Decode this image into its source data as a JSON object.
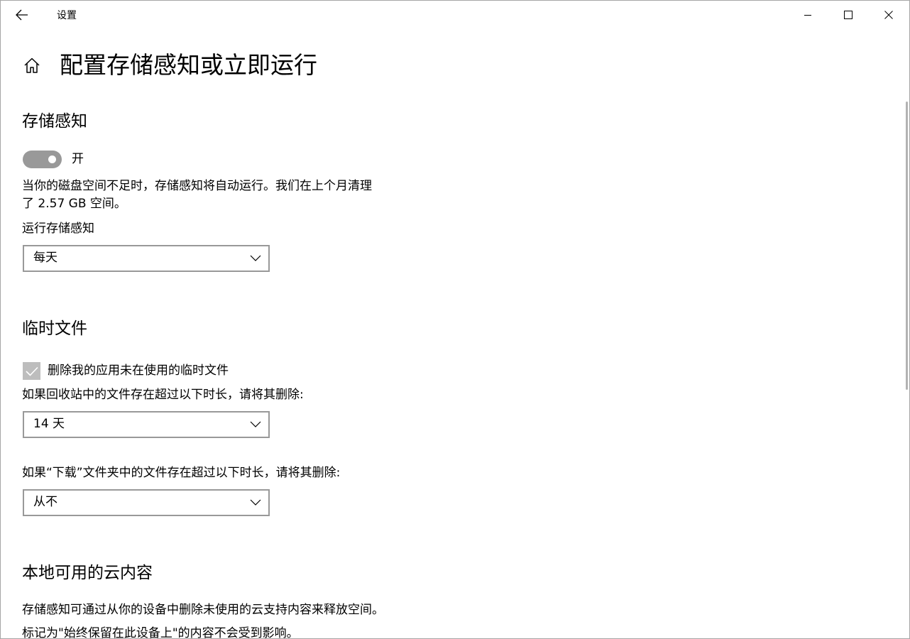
{
  "window": {
    "app_title": "设置"
  },
  "header": {
    "page_title": "配置存储感知或立即运行"
  },
  "storage_sense": {
    "section_title": "存储感知",
    "toggle_state": "开",
    "description_line1": "当你的磁盘空间不足时，存储感知将自动运行。我们在上个月清理",
    "description_line2": "了 2.57 GB 空间。",
    "run_label": "运行存储感知",
    "run_value": "每天"
  },
  "temp_files": {
    "section_title": "临时文件",
    "delete_temp_label": "删除我的应用未在使用的临时文件",
    "delete_temp_checked": true,
    "recycle_label": "如果回收站中的文件存在超过以下时长，请将其删除:",
    "recycle_value": "14 天",
    "downloads_label": "如果“下载”文件夹中的文件存在超过以下时长，请将其删除:",
    "downloads_value": "从不"
  },
  "cloud_content": {
    "section_title": "本地可用的云内容",
    "description_line1": "存储感知可通过从你的设备中删除未使用的云支持内容来释放空间。",
    "description_line2": "标记为\"始终保留在此设备上\"的内容不会受到影响。"
  },
  "icons": {
    "back": "back-arrow-icon",
    "minimize": "minimize-icon",
    "maximize": "maximize-icon",
    "close": "close-icon",
    "home": "home-icon",
    "chevron": "chevron-down-icon",
    "check": "checkmark-icon"
  },
  "colors": {
    "toggle_track": "#999999",
    "checkbox_fill": "#bdbdbd",
    "dropdown_border": "#999999",
    "scrollbar": "#b3b3b3"
  }
}
